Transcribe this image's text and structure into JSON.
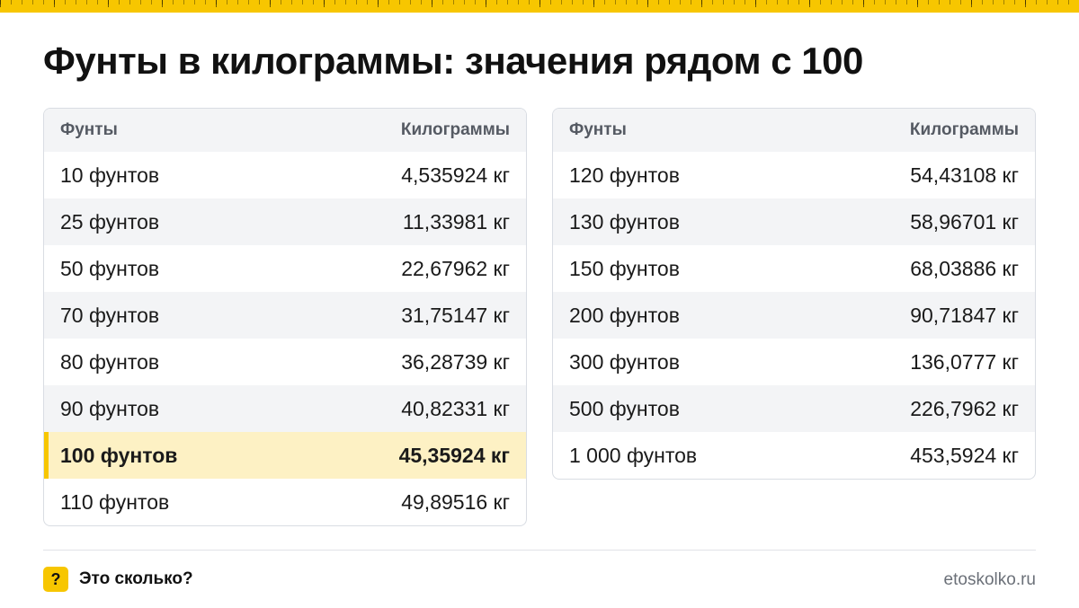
{
  "title": "Фунты в килограммы: значения рядом с 100",
  "colors": {
    "accent": "#f7c600",
    "highlight_row": "#fdf1c4",
    "stripe": "#f3f4f6"
  },
  "tables": [
    {
      "header": {
        "col1": "Фунты",
        "col2": "Килограммы"
      },
      "rows": [
        {
          "pounds": "10 фунтов",
          "kg": "4,535924 кг"
        },
        {
          "pounds": "25 фунтов",
          "kg": "11,33981 кг"
        },
        {
          "pounds": "50 фунтов",
          "kg": "22,67962 кг"
        },
        {
          "pounds": "70 фунтов",
          "kg": "31,75147 кг"
        },
        {
          "pounds": "80 фунтов",
          "kg": "36,28739 кг"
        },
        {
          "pounds": "90 фунтов",
          "kg": "40,82331 кг"
        },
        {
          "pounds": "100 фунтов",
          "kg": "45,35924 кг",
          "highlight": true
        },
        {
          "pounds": "110 фунтов",
          "kg": "49,89516 кг"
        }
      ]
    },
    {
      "header": {
        "col1": "Фунты",
        "col2": "Килограммы"
      },
      "rows": [
        {
          "pounds": "120 фунтов",
          "kg": "54,43108 кг"
        },
        {
          "pounds": "130 фунтов",
          "kg": "58,96701 кг"
        },
        {
          "pounds": "150 фунтов",
          "kg": "68,03886 кг"
        },
        {
          "pounds": "200 фунтов",
          "kg": "90,71847 кг"
        },
        {
          "pounds": "300 фунтов",
          "kg": "136,0777 кг"
        },
        {
          "pounds": "500 фунтов",
          "kg": "226,7962 кг"
        },
        {
          "pounds": "1 000 фунтов",
          "kg": "453,5924 кг"
        }
      ]
    }
  ],
  "footer": {
    "badge_icon": "question-mark-icon",
    "badge_glyph": "?",
    "brand": "Это сколько?",
    "site": "etoskolko.ru"
  }
}
